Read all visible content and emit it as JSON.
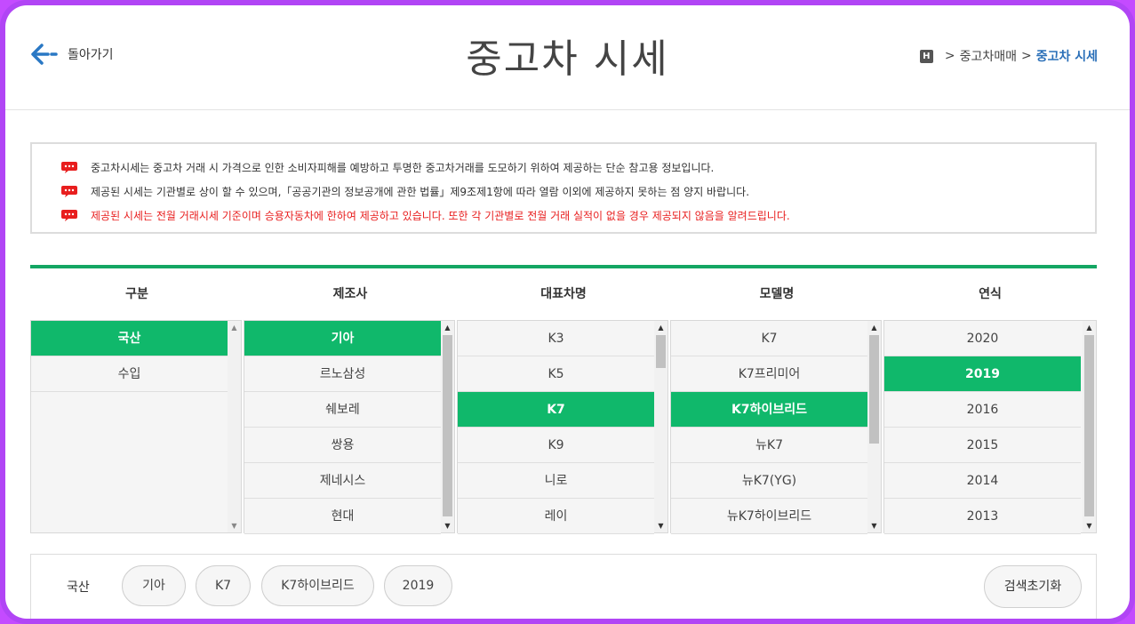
{
  "header": {
    "back_label": "돌아가기",
    "title": "중고차 시세",
    "breadcrumb": {
      "home_icon_label": "H",
      "sep": ">",
      "items": [
        "중고차매매",
        "중고차 시세"
      ]
    }
  },
  "notice": {
    "lines": [
      "중고차시세는 중고차 거래 시 가격으로 인한 소비자피해를 예방하고 투명한 중고차거래를 도모하기 위하여 제공하는 단순 참고용 정보입니다.",
      "제공된 시세는 기관별로 상이 할 수 있으며,「공공기관의 정보공개에 관한 법률」제9조제1항에 따라 열람 이외에 제공하지 못하는 점 양지 바랍니다.",
      "제공된 시세는 전월 거래시세 기준이며 승용자동차에 한하여 제공하고 있습니다. 또한 각 기관별로 전월 거래 실적이 없을 경우 제공되지 않음을 알려드립니다."
    ],
    "highlight_color": "#e81e1e"
  },
  "selector": {
    "accent_color": "#10b86b",
    "columns": [
      {
        "heading": "구분",
        "items": [
          "국산",
          "수입"
        ],
        "selected": "국산"
      },
      {
        "heading": "제조사",
        "items": [
          "기아",
          "르노삼성",
          "쉐보레",
          "쌍용",
          "제네시스",
          "현대"
        ],
        "selected": "기아"
      },
      {
        "heading": "대표차명",
        "items": [
          "K3",
          "K5",
          "K7",
          "K9",
          "니로",
          "레이"
        ],
        "selected": "K7"
      },
      {
        "heading": "모델명",
        "items": [
          "K7",
          "K7프리미어",
          "K7하이브리드",
          "뉴K7",
          "뉴K7(YG)",
          "뉴K7하이브리드"
        ],
        "selected": "K7하이브리드"
      },
      {
        "heading": "연식",
        "items": [
          "2020",
          "2019",
          "2016",
          "2015",
          "2014",
          "2013"
        ],
        "selected": "2019"
      }
    ]
  },
  "picked": {
    "label": "국산",
    "chips": [
      "기아",
      "K7",
      "K7하이브리드",
      "2019"
    ],
    "reset_label": "검색초기화"
  }
}
